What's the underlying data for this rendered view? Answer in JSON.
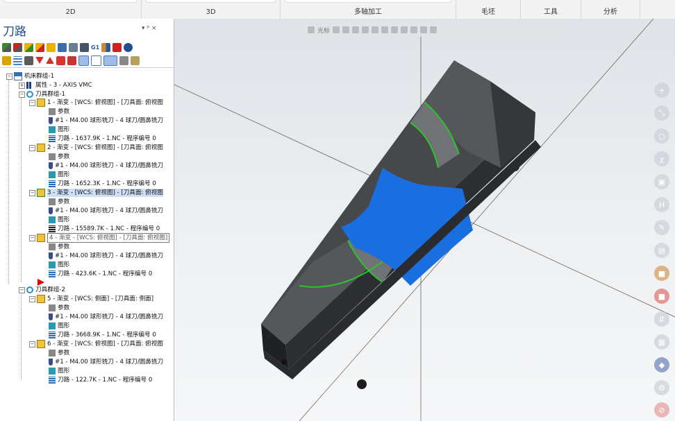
{
  "ribbon": {
    "groups": [
      "2D",
      "3D",
      "多轴加工",
      "毛坯",
      "工具",
      "分析"
    ]
  },
  "panel": {
    "title": "刀路",
    "ctrl_pin": "▾ ᵖ ×"
  },
  "tree": {
    "root": "机床群组-1",
    "props": "属性 - 3 - AXIS VMC",
    "group1": "刀具群组-1",
    "ops": [
      {
        "name": "1 - 渐变 - [WCS: 俯视图] - [刀具面: 俯视图",
        "params": "参数",
        "tool": "#1 - M4.00 球形铣刀 - 4 球刀/圆鼻铣刀",
        "geom": "图形",
        "path": "刀路 - 1637.9K - 1.NC - 程序编号 0"
      },
      {
        "name": "2 - 渐变 - [WCS: 俯视图] - [刀具面: 俯视图",
        "params": "参数",
        "tool": "#1 - M4.00 球形铣刀 - 4 球刀/圆鼻铣刀",
        "geom": "图形",
        "path": "刀路 - 1652.3K - 1.NC - 程序编号 0"
      },
      {
        "name": "3 - 渐变 - [WCS: 俯视图] - [刀具面: 俯视图",
        "params": "参数",
        "tool": "#1 - M4.00 球形铣刀 - 4 球刀/圆鼻铣刀",
        "geom": "图形",
        "path": "刀路 - 15589.7K - 1.NC - 程序编号 0"
      },
      {
        "name": "4 - 渐变 - [WCS: 俯视图] - [刀具面: 俯视图]",
        "params": "参数",
        "tool": "#1 - M4.00 球形铣刀 - 4 球刀/圆鼻铣刀",
        "geom": "图形",
        "path": "刀路 - 423.6K - 1.NC - 程序编号 0"
      }
    ],
    "group2": "刀具群组-2",
    "ops2": [
      {
        "name": "5 - 渐变 - [WCS: 侧面] - [刀具面: 侧面]",
        "params": "参数",
        "tool": "#1 - M4.00 球形铣刀 - 4 球刀/圆鼻铣刀",
        "geom": "图形",
        "path": "刀路 - 3668.9K - 1.NC - 程序编号 0"
      },
      {
        "name": "6 - 渐变 - [WCS: 俯视图] - [刀具面: 俯视图",
        "params": "参数",
        "tool": "#1 - M4.00 球形铣刀 - 4 球刀/圆鼻铣刀",
        "geom": "图形",
        "path": "刀路 - 122.7K - 1.NC - 程序编号 0"
      }
    ]
  },
  "viewport": {
    "toolbar_label": "光标"
  },
  "colors": {
    "accent": "#1f4e8c",
    "selection_blue": "#1a6fe0",
    "contour_green": "#2bc42b",
    "part_dark": "#3a3c3f"
  }
}
